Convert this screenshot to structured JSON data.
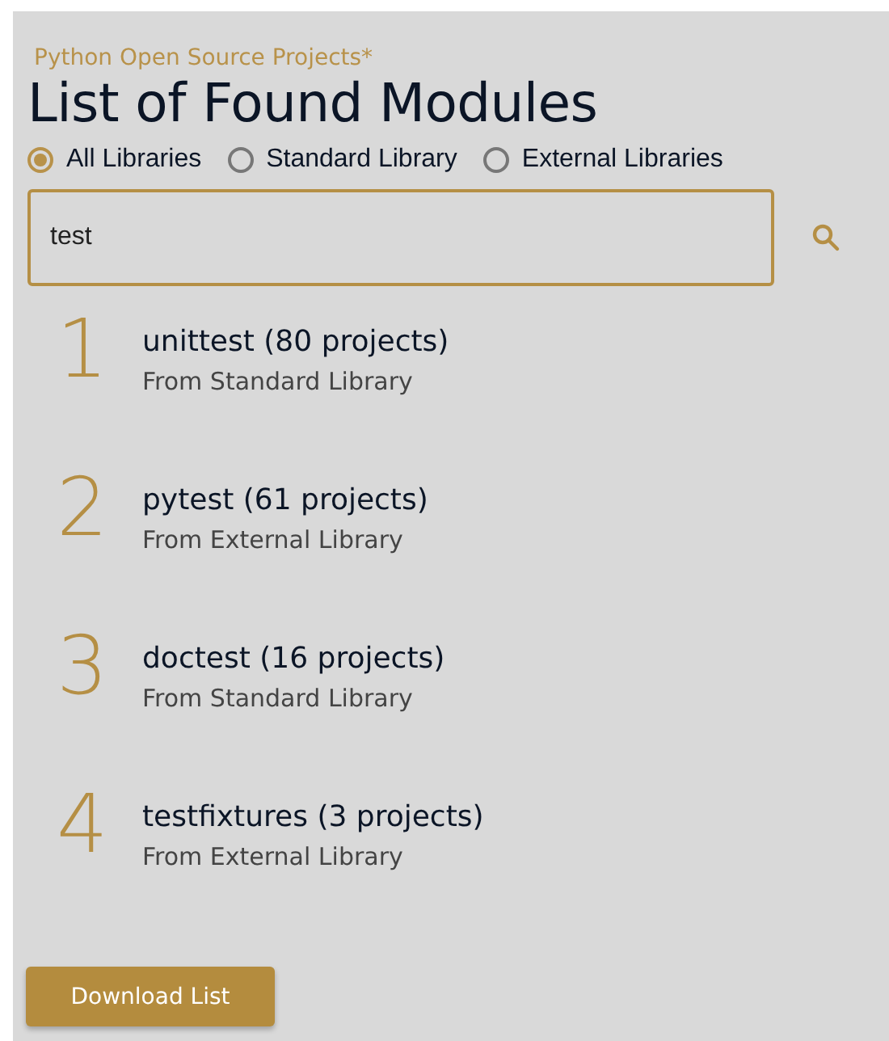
{
  "header": {
    "subtitle": "Python Open Source Projects*",
    "title": "List of Found Modules"
  },
  "filters": [
    {
      "label": "All Libraries",
      "selected": true
    },
    {
      "label": "Standard Library",
      "selected": false
    },
    {
      "label": "External Libraries",
      "selected": false
    }
  ],
  "search": {
    "value": "test"
  },
  "results": [
    {
      "rank": "1",
      "name": "unittest (80 projects)",
      "source": "From Standard Library"
    },
    {
      "rank": "2",
      "name": "pytest (61 projects)",
      "source": "From External Library"
    },
    {
      "rank": "3",
      "name": "doctest (16 projects)",
      "source": "From Standard Library"
    },
    {
      "rank": "4",
      "name": "testfixtures (3 projects)",
      "source": "From External Library"
    }
  ],
  "buttons": [
    "Download List"
  ]
}
